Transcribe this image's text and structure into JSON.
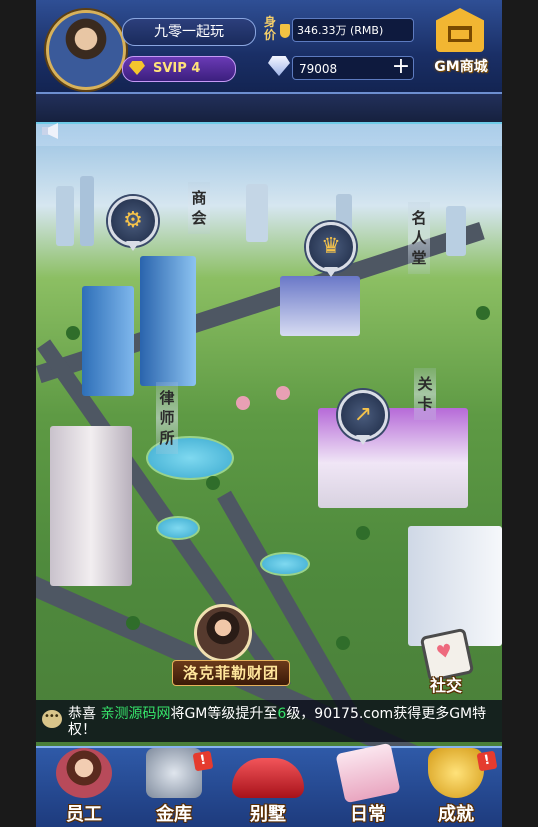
{
  "player": {
    "name": "九零一起玩",
    "vip": "SVIP 4",
    "worth_label": "身价",
    "worth": "346.33万 (RMB)",
    "diamonds": "79008",
    "add": "+"
  },
  "shop": {
    "label": "GM商城"
  },
  "map": {
    "labels": {
      "chamber": "商会",
      "hall_of_fame": "名人堂",
      "law_firm": "律师所",
      "level": "关卡"
    },
    "npc_name": "洛克菲勒财团",
    "social": "社交"
  },
  "broadcast": {
    "prefix": "恭喜 ",
    "user": "亲测源码网",
    "middle": "将GM等级提升至",
    "level": "6",
    "suffix": "级，90175.com获得更多GM特权！"
  },
  "bottom_nav": [
    {
      "label": "员工",
      "badge": ""
    },
    {
      "label": "金库",
      "badge": "!"
    },
    {
      "label": "别墅",
      "badge": ""
    },
    {
      "label": "日常",
      "badge": ""
    },
    {
      "label": "成就",
      "badge": "!"
    }
  ],
  "colors": {
    "highlight": "#36e36a",
    "gold": "#f2b632",
    "topbar": "#1a2f66"
  }
}
